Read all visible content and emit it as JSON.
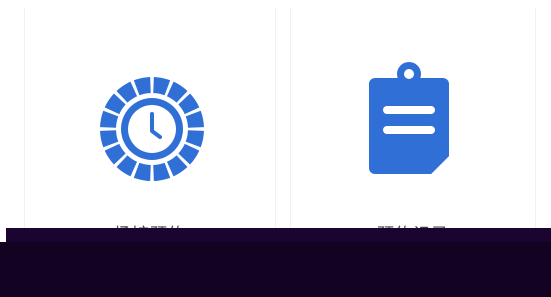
{
  "tiles": [
    {
      "label": "场馆预约",
      "icon": "clock-icon",
      "color": "#2f6fd6"
    },
    {
      "label": "预约记录",
      "icon": "clipboard-icon",
      "color": "#2f6fd6"
    }
  ],
  "overlay_color": "#150325"
}
